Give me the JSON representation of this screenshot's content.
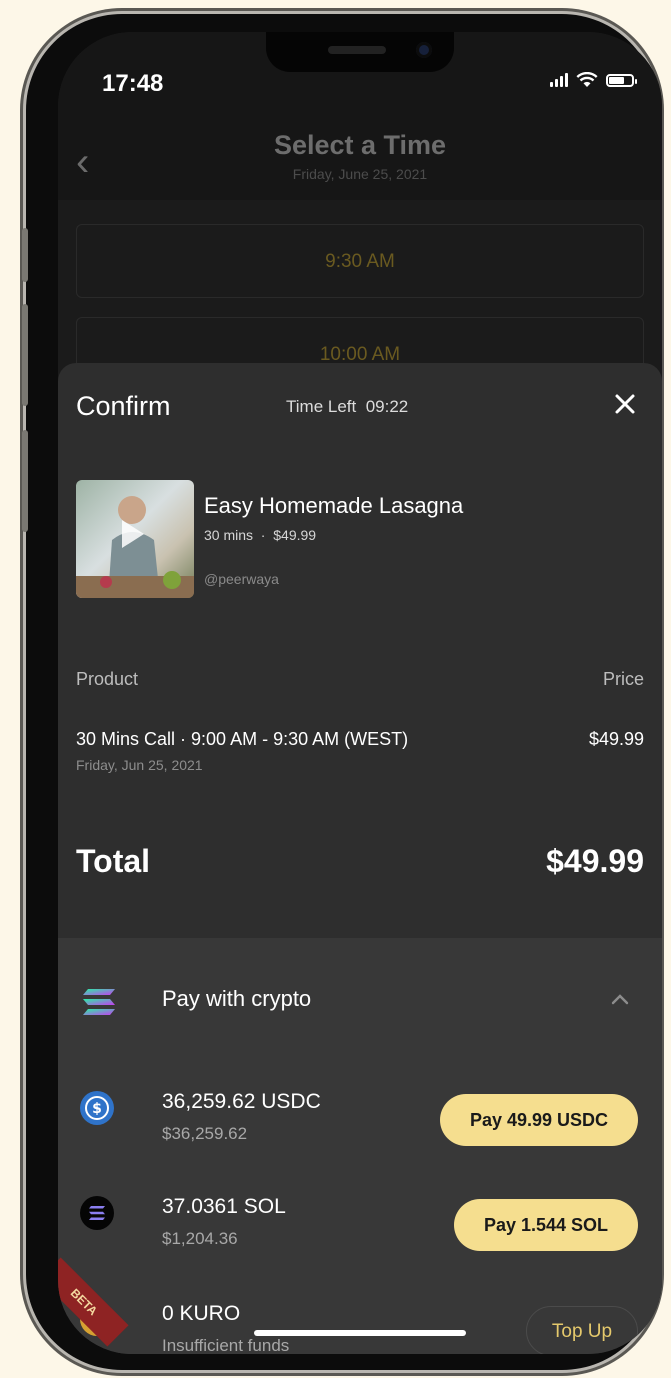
{
  "status_bar": {
    "time": "17:48"
  },
  "header": {
    "title": "Select a Time",
    "subtitle": "Friday, June 25, 2021"
  },
  "time_slots": [
    "9:30 AM",
    "10:00 AM"
  ],
  "confirm": {
    "title": "Confirm",
    "time_left_label": "Time Left",
    "time_left_value": "09:22",
    "product": {
      "title": "Easy Homemade Lasagna",
      "duration": "30 mins",
      "price": "$49.99",
      "handle": "@peerwaya"
    },
    "table": {
      "product_header": "Product",
      "price_header": "Price",
      "item": "30 Mins Call · 9:00 AM - 9:30 AM (WEST)",
      "item_date": "Friday, Jun 25, 2021",
      "item_price": "$49.99"
    },
    "total_label": "Total",
    "total_value": "$49.99"
  },
  "payment": {
    "title": "Pay with crypto",
    "options": [
      {
        "amount": "36,259.62 USDC",
        "usd": "$36,259.62",
        "button": "Pay  49.99 USDC",
        "icon": "usdc-icon"
      },
      {
        "amount": "37.0361 SOL",
        "usd": "$1,204.36",
        "button": "Pay  1.544 SOL",
        "icon": "solana-icon"
      },
      {
        "amount": "0 KURO",
        "usd": "Insufficient funds",
        "button": "Top Up",
        "icon": "kuro-icon"
      }
    ]
  },
  "beta_label": "BETA",
  "colors": {
    "accent": "#f5de8f",
    "gold_text": "#e5c96c",
    "sheet": "#2e2e2e"
  }
}
